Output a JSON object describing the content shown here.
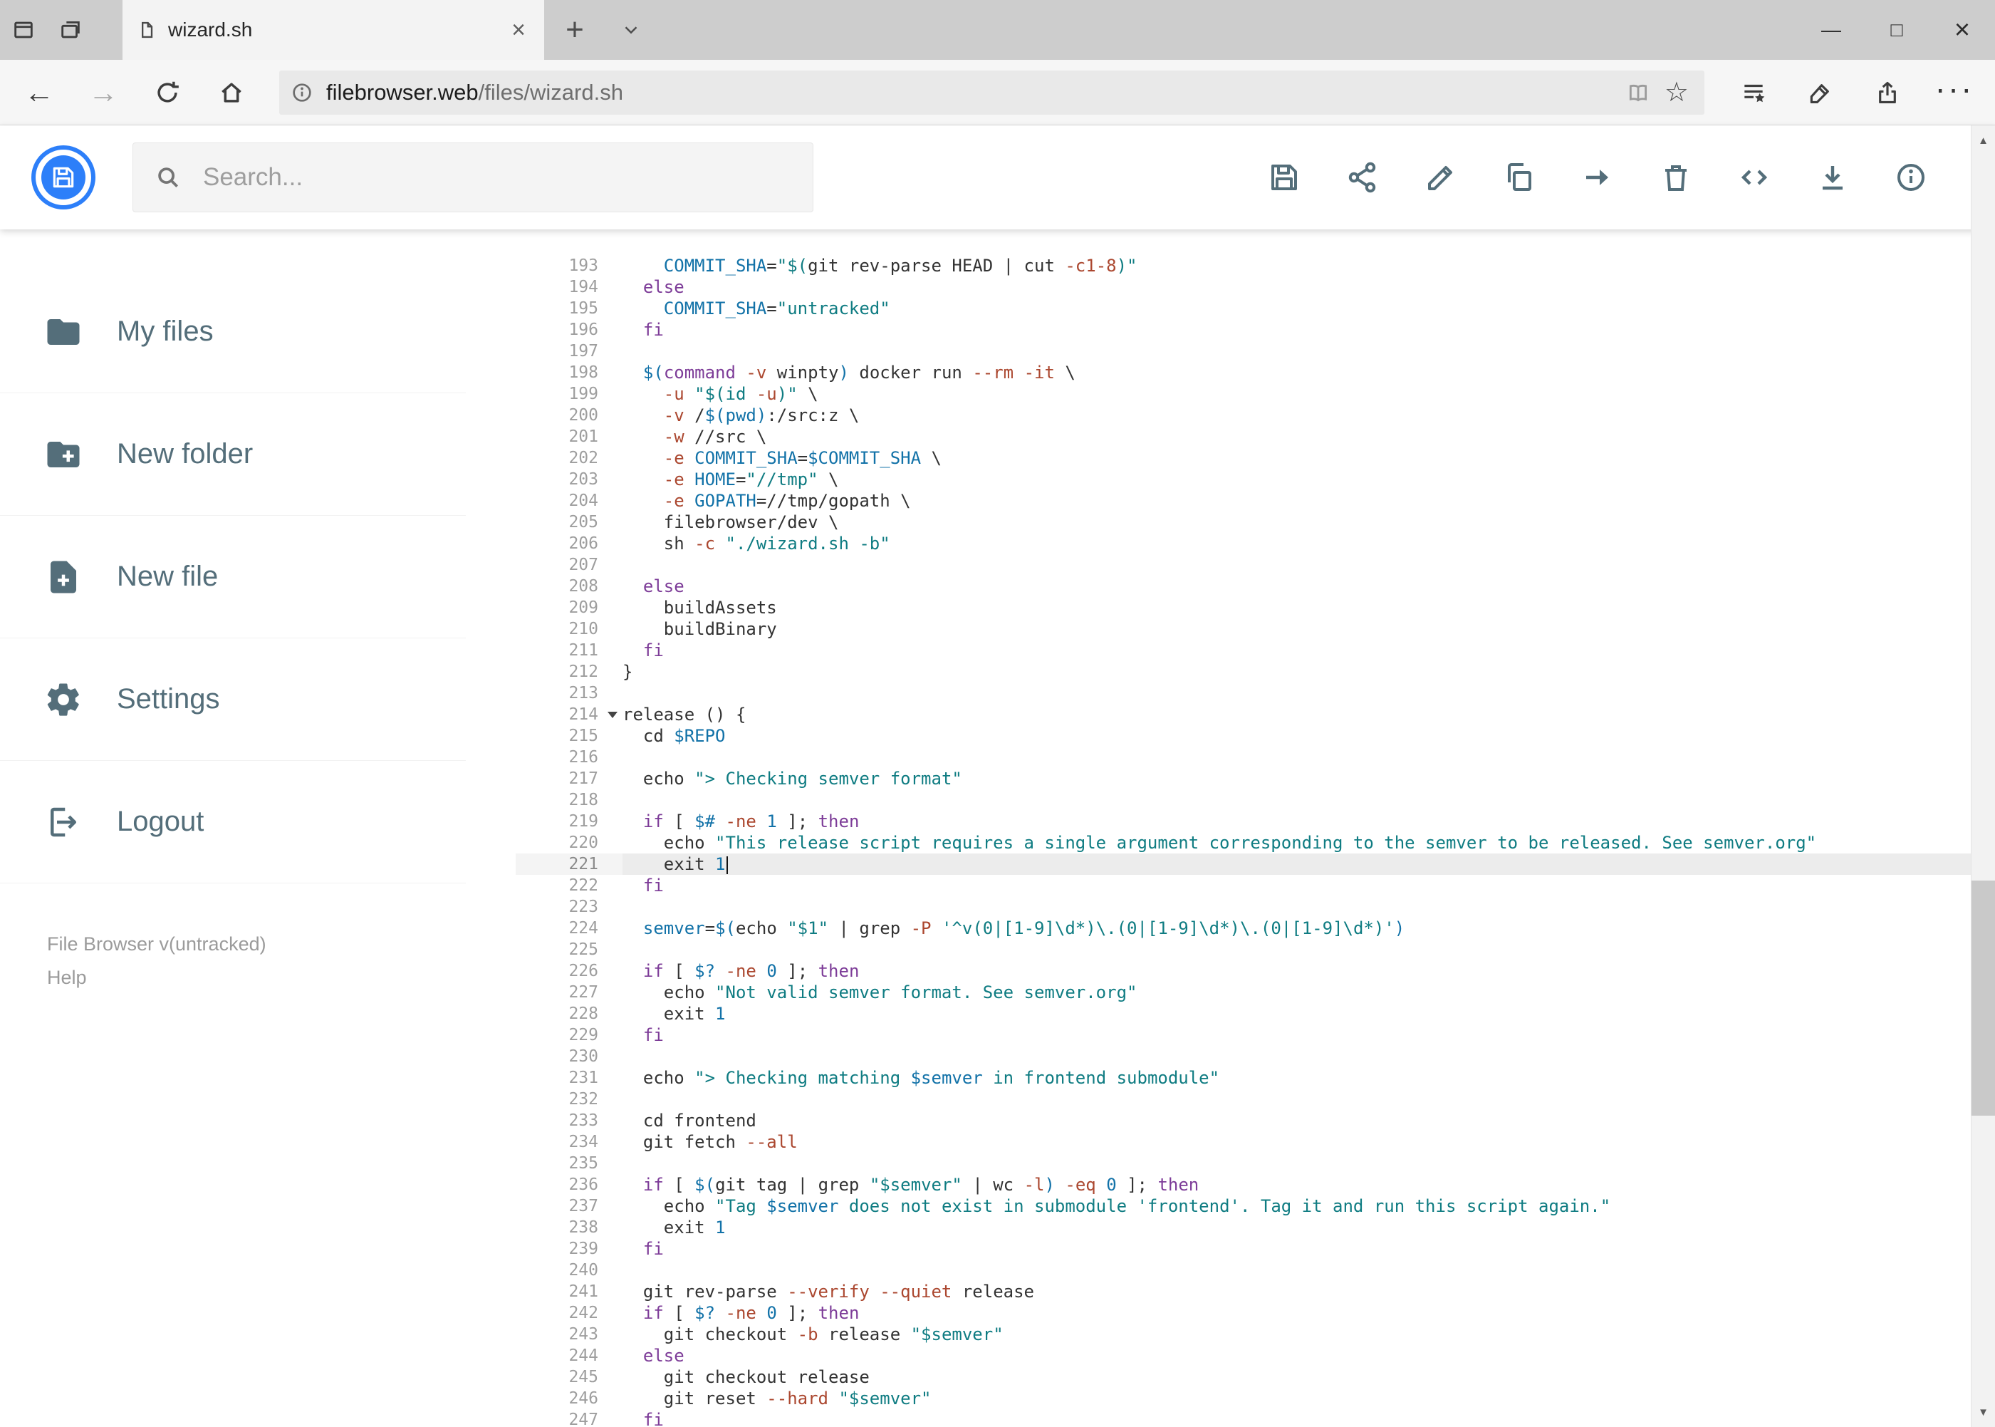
{
  "browser": {
    "tab": {
      "title": "wizard.sh"
    },
    "url": {
      "domain": "filebrowser.web",
      "path": "/files/wizard.sh"
    },
    "glyphs": {
      "back": "←",
      "forward": "→",
      "star": "☆",
      "more": "···",
      "minimize": "—",
      "maximize": "□",
      "close": "×",
      "tab_close": "×",
      "new_tab": "+",
      "scroll_up": "▲",
      "scroll_down": "▼"
    }
  },
  "header": {
    "search_placeholder": "Search...",
    "toolbar_icons": [
      "save",
      "share",
      "rename",
      "copy",
      "move",
      "delete",
      "code",
      "download",
      "info"
    ]
  },
  "sidebar": {
    "items": [
      {
        "label": "My files",
        "icon": "folder"
      },
      {
        "label": "New folder",
        "icon": "folder-plus"
      },
      {
        "label": "New file",
        "icon": "file-plus"
      },
      {
        "label": "Settings",
        "icon": "gear"
      },
      {
        "label": "Logout",
        "icon": "logout"
      }
    ],
    "footer": {
      "version": "File Browser v(untracked)",
      "help": "Help"
    }
  },
  "editor": {
    "first_line": 193,
    "active_line": 221,
    "fold_lines": [
      214
    ],
    "lines": [
      [
        [
          "p",
          "    "
        ],
        [
          "v",
          "COMMIT_SHA"
        ],
        [
          "p",
          "="
        ],
        [
          "s",
          "\"$("
        ],
        [
          "p",
          "git rev-parse HEAD | cut "
        ],
        [
          "f",
          "-c1-8"
        ],
        [
          "s",
          ")\""
        ]
      ],
      [
        [
          "p",
          "  "
        ],
        [
          "k",
          "else"
        ]
      ],
      [
        [
          "p",
          "    "
        ],
        [
          "v",
          "COMMIT_SHA"
        ],
        [
          "p",
          "="
        ],
        [
          "s",
          "\"untracked\""
        ]
      ],
      [
        [
          "p",
          "  "
        ],
        [
          "k",
          "fi"
        ]
      ],
      [],
      [
        [
          "p",
          "  "
        ],
        [
          "v",
          "$("
        ],
        [
          "k",
          "command"
        ],
        [
          "p",
          " "
        ],
        [
          "f",
          "-v"
        ],
        [
          "p",
          " winpty"
        ],
        [
          "v",
          ")"
        ],
        [
          "p",
          " docker run "
        ],
        [
          "f",
          "--rm"
        ],
        [
          "p",
          " "
        ],
        [
          "f",
          "-it"
        ],
        [
          "p",
          " \\"
        ]
      ],
      [
        [
          "p",
          "    "
        ],
        [
          "f",
          "-u"
        ],
        [
          "p",
          " "
        ],
        [
          "s",
          "\"$(id "
        ],
        [
          "f",
          "-u"
        ],
        [
          "s",
          ")\""
        ],
        [
          "p",
          " \\"
        ]
      ],
      [
        [
          "p",
          "    "
        ],
        [
          "f",
          "-v"
        ],
        [
          "p",
          " /"
        ],
        [
          "v",
          "$(pwd)"
        ],
        [
          "p",
          ":/src:z \\"
        ]
      ],
      [
        [
          "p",
          "    "
        ],
        [
          "f",
          "-w"
        ],
        [
          "p",
          " //src \\"
        ]
      ],
      [
        [
          "p",
          "    "
        ],
        [
          "f",
          "-e"
        ],
        [
          "p",
          " "
        ],
        [
          "v",
          "COMMIT_SHA"
        ],
        [
          "p",
          "="
        ],
        [
          "v",
          "$COMMIT_SHA"
        ],
        [
          "p",
          " \\"
        ]
      ],
      [
        [
          "p",
          "    "
        ],
        [
          "f",
          "-e"
        ],
        [
          "p",
          " "
        ],
        [
          "v",
          "HOME"
        ],
        [
          "p",
          "="
        ],
        [
          "s",
          "\"//tmp\""
        ],
        [
          "p",
          " \\"
        ]
      ],
      [
        [
          "p",
          "    "
        ],
        [
          "f",
          "-e"
        ],
        [
          "p",
          " "
        ],
        [
          "v",
          "GOPATH"
        ],
        [
          "p",
          "=//tmp/gopath \\"
        ]
      ],
      [
        [
          "p",
          "    filebrowser/dev \\"
        ]
      ],
      [
        [
          "p",
          "    sh "
        ],
        [
          "f",
          "-c"
        ],
        [
          "p",
          " "
        ],
        [
          "s",
          "\"./wizard.sh -b\""
        ]
      ],
      [],
      [
        [
          "p",
          "  "
        ],
        [
          "k",
          "else"
        ]
      ],
      [
        [
          "p",
          "    buildAssets"
        ]
      ],
      [
        [
          "p",
          "    buildBinary"
        ]
      ],
      [
        [
          "p",
          "  "
        ],
        [
          "k",
          "fi"
        ]
      ],
      [
        [
          "p",
          "}"
        ]
      ],
      [],
      [
        [
          "p",
          "release () {"
        ]
      ],
      [
        [
          "p",
          "  cd "
        ],
        [
          "v",
          "$REPO"
        ]
      ],
      [],
      [
        [
          "p",
          "  echo "
        ],
        [
          "s",
          "\"> Checking semver format\""
        ]
      ],
      [],
      [
        [
          "p",
          "  "
        ],
        [
          "k",
          "if"
        ],
        [
          "p",
          " [ "
        ],
        [
          "v",
          "$#"
        ],
        [
          "p",
          " "
        ],
        [
          "f",
          "-ne"
        ],
        [
          "p",
          " "
        ],
        [
          "n",
          "1"
        ],
        [
          "p",
          " ]; "
        ],
        [
          "k",
          "then"
        ]
      ],
      [
        [
          "p",
          "    echo "
        ],
        [
          "s",
          "\"This release script requires a single argument corresponding to the semver to be released. See semver.org\""
        ]
      ],
      [
        [
          "p",
          "    exit "
        ],
        [
          "n",
          "1"
        ]
      ],
      [
        [
          "p",
          "  "
        ],
        [
          "k",
          "fi"
        ]
      ],
      [],
      [
        [
          "p",
          "  "
        ],
        [
          "v",
          "semver"
        ],
        [
          "p",
          "="
        ],
        [
          "v",
          "$("
        ],
        [
          "p",
          "echo "
        ],
        [
          "s",
          "\"$1\""
        ],
        [
          "p",
          " | grep "
        ],
        [
          "f",
          "-P"
        ],
        [
          "p",
          " "
        ],
        [
          "s",
          "'^v(0|[1-9]\\d*)\\.(0|[1-9]\\d*)\\.(0|[1-9]\\d*)'"
        ],
        [
          "v",
          ")"
        ]
      ],
      [],
      [
        [
          "p",
          "  "
        ],
        [
          "k",
          "if"
        ],
        [
          "p",
          " [ "
        ],
        [
          "v",
          "$?"
        ],
        [
          "p",
          " "
        ],
        [
          "f",
          "-ne"
        ],
        [
          "p",
          " "
        ],
        [
          "n",
          "0"
        ],
        [
          "p",
          " ]; "
        ],
        [
          "k",
          "then"
        ]
      ],
      [
        [
          "p",
          "    echo "
        ],
        [
          "s",
          "\"Not valid semver format. See semver.org\""
        ]
      ],
      [
        [
          "p",
          "    exit "
        ],
        [
          "n",
          "1"
        ]
      ],
      [
        [
          "p",
          "  "
        ],
        [
          "k",
          "fi"
        ]
      ],
      [],
      [
        [
          "p",
          "  echo "
        ],
        [
          "s",
          "\"> Checking matching "
        ],
        [
          "v",
          "$semver"
        ],
        [
          "s",
          " in frontend submodule\""
        ]
      ],
      [],
      [
        [
          "p",
          "  cd frontend"
        ]
      ],
      [
        [
          "p",
          "  git fetch "
        ],
        [
          "f",
          "--all"
        ]
      ],
      [],
      [
        [
          "p",
          "  "
        ],
        [
          "k",
          "if"
        ],
        [
          "p",
          " [ "
        ],
        [
          "v",
          "$("
        ],
        [
          "p",
          "git tag | grep "
        ],
        [
          "s",
          "\"$semver\""
        ],
        [
          "p",
          " | wc "
        ],
        [
          "f",
          "-l"
        ],
        [
          "v",
          ")"
        ],
        [
          "p",
          " "
        ],
        [
          "f",
          "-eq"
        ],
        [
          "p",
          " "
        ],
        [
          "n",
          "0"
        ],
        [
          "p",
          " ]; "
        ],
        [
          "k",
          "then"
        ]
      ],
      [
        [
          "p",
          "    echo "
        ],
        [
          "s",
          "\"Tag "
        ],
        [
          "v",
          "$semver"
        ],
        [
          "s",
          " does not exist in submodule 'frontend'. Tag it and run this script again.\""
        ]
      ],
      [
        [
          "p",
          "    exit "
        ],
        [
          "n",
          "1"
        ]
      ],
      [
        [
          "p",
          "  "
        ],
        [
          "k",
          "fi"
        ]
      ],
      [],
      [
        [
          "p",
          "  git rev-parse "
        ],
        [
          "f",
          "--verify"
        ],
        [
          "p",
          " "
        ],
        [
          "f",
          "--quiet"
        ],
        [
          "p",
          " release"
        ]
      ],
      [
        [
          "p",
          "  "
        ],
        [
          "k",
          "if"
        ],
        [
          "p",
          " [ "
        ],
        [
          "v",
          "$?"
        ],
        [
          "p",
          " "
        ],
        [
          "f",
          "-ne"
        ],
        [
          "p",
          " "
        ],
        [
          "n",
          "0"
        ],
        [
          "p",
          " ]; "
        ],
        [
          "k",
          "then"
        ]
      ],
      [
        [
          "p",
          "    git checkout "
        ],
        [
          "f",
          "-b"
        ],
        [
          "p",
          " release "
        ],
        [
          "s",
          "\"$semver\""
        ]
      ],
      [
        [
          "p",
          "  "
        ],
        [
          "k",
          "else"
        ]
      ],
      [
        [
          "p",
          "    git checkout release"
        ]
      ],
      [
        [
          "p",
          "    git reset "
        ],
        [
          "f",
          "--hard"
        ],
        [
          "p",
          " "
        ],
        [
          "s",
          "\"$semver\""
        ]
      ],
      [
        [
          "p",
          "  "
        ],
        [
          "k",
          "fi"
        ]
      ]
    ]
  },
  "colors": {
    "accent": "#2d7ff9",
    "icon": "#546e7a",
    "plain": "#333333",
    "keyword": "#7d3c98",
    "string": "#0f7c82",
    "variable": "#1272a8",
    "flag": "#ab472f",
    "number": "#1272a8"
  }
}
